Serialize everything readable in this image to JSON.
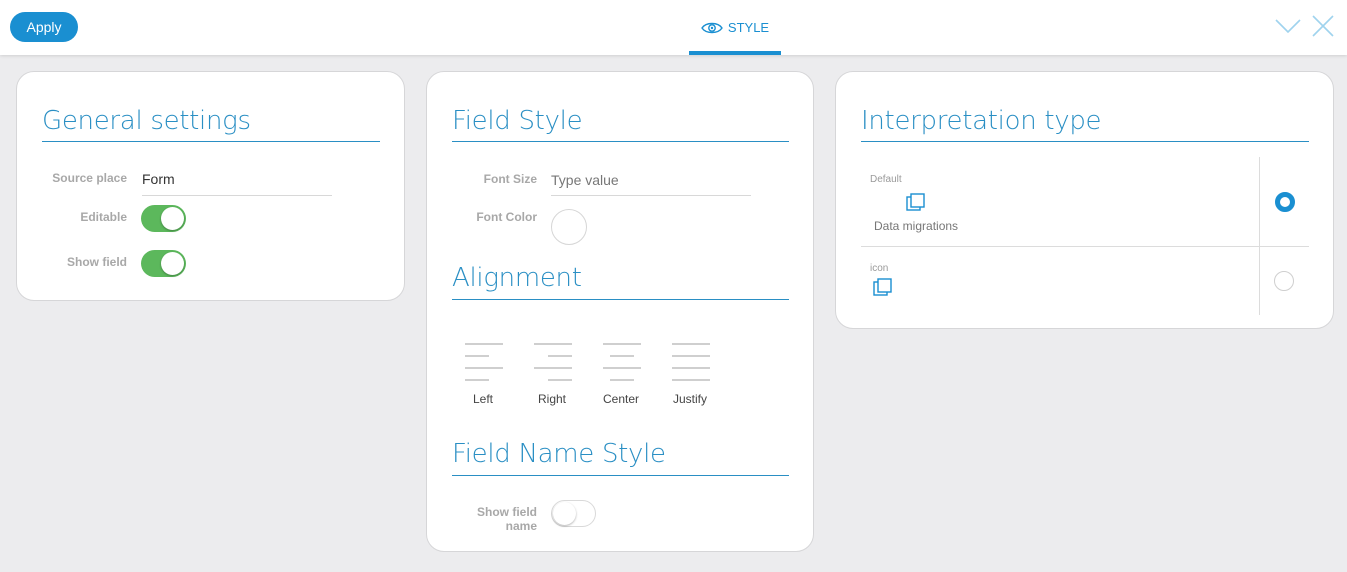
{
  "toolbar": {
    "apply_label": "Apply",
    "tab_label": "STYLE"
  },
  "general_settings": {
    "title": "General settings",
    "source_place_label": "Source place",
    "source_place_value": "Form",
    "editable_label": "Editable",
    "editable_on": true,
    "show_field_label": "Show field",
    "show_field_on": true
  },
  "field_style": {
    "title": "Field Style",
    "font_size_label": "Font Size",
    "font_size_placeholder": "Type value",
    "font_color_label": "Font Color",
    "alignment_title": "Alignment",
    "alignment_options": [
      "Left",
      "Right",
      "Center",
      "Justify"
    ],
    "field_name_style_title": "Field Name Style",
    "show_field_name_label_1": "Show field",
    "show_field_name_label_2": "name",
    "show_field_name_on": false
  },
  "interpretation": {
    "title": "Interpretation type",
    "options": [
      {
        "small_label": "Default",
        "description": "Data migrations",
        "selected": true
      },
      {
        "small_label": "icon",
        "description": "",
        "selected": false
      }
    ]
  },
  "colors": {
    "accent": "#1a8fd1",
    "toggle_on": "#5cb85c"
  },
  "icons": {
    "tab": "eye-icon",
    "collapse": "chevron-down-icon",
    "close": "close-icon",
    "interpretation": "copy-icon"
  }
}
